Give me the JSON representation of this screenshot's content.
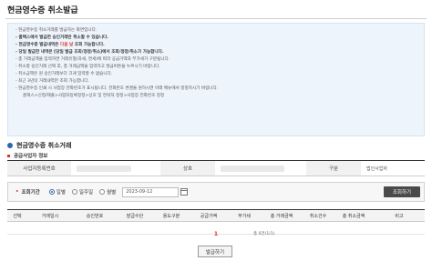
{
  "page": {
    "title": "현금영수증 취소발급"
  },
  "notice": {
    "items": [
      {
        "text": "현금영수증 취소거래를 발급하는 화면입니다.",
        "style": ""
      },
      {
        "text": "홈택스에서 발급한 승인거래만 취소할 수 있습니다.",
        "style": "bold"
      },
      {
        "pre": "현금영수증 발급내역은 ",
        "red": "다음 날",
        "post": " 조회 가능합니다.",
        "style": "bold"
      },
      {
        "text": "당일 발급한 내역은 [당일 발급 조회/정정/취소]에서 조회/정정/취소가 가능합니다.",
        "style": "bold"
      },
      {
        "text": "총 거래금액을 입력하면 거래유형(과세, 면세)에 따라 공급가액과 부가세가 구분됩니다.",
        "style": ""
      },
      {
        "text": "취소할 승인거래 선택 후, 총 거래금액을 입력하고 발급버튼을 누르시기 바랍니다.",
        "style": ""
      },
      {
        "text": "취소금액은 원 승인거래보다 크게 입력할 수 없습니다.",
        "style": ""
      },
      {
        "text": "최근 3년의 거래내역만 조회 가능합니다.",
        "style": ""
      },
      {
        "text": "현금영수증 인쇄 시 사업장 전화번호가 표시됩니다. 전화번호 변경을 원하시면 아래 메뉴에서 정정하시기 바랍니다.",
        "style": ""
      },
      {
        "text": "홈택스>신청/제출>사업자등록정정>상호 및 연락처 정정>사업장 전화번호 정정",
        "style": "indent"
      }
    ]
  },
  "section": {
    "title": "현금영수증 취소거래",
    "sub_title": "공급사업자 정보"
  },
  "info": {
    "biz_no_label": "사업자등록번호",
    "name_label": "상호",
    "type_label": "구분",
    "type_value": "법인사업자"
  },
  "search": {
    "period_label": "조회기간",
    "options": [
      "일별",
      "일주일",
      "월별"
    ],
    "selected_index": 0,
    "date_value": "2023-09-12",
    "button_label": "조회하기"
  },
  "result": {
    "columns": [
      "선택",
      "거래일시",
      "승인번호",
      "발급수단",
      "용도구분",
      "공급가액",
      "부가세",
      "총 거래금액",
      "취소건수",
      "총 취소금액",
      "비고"
    ]
  },
  "pager": {
    "current": "1",
    "count_text": "총 0건(1/1)"
  },
  "actions": {
    "issue_label": "발급하기"
  },
  "colors": {
    "accent": "#2a67b1",
    "highlight": "#e0302a",
    "notice_bg": "#eef4fb"
  }
}
